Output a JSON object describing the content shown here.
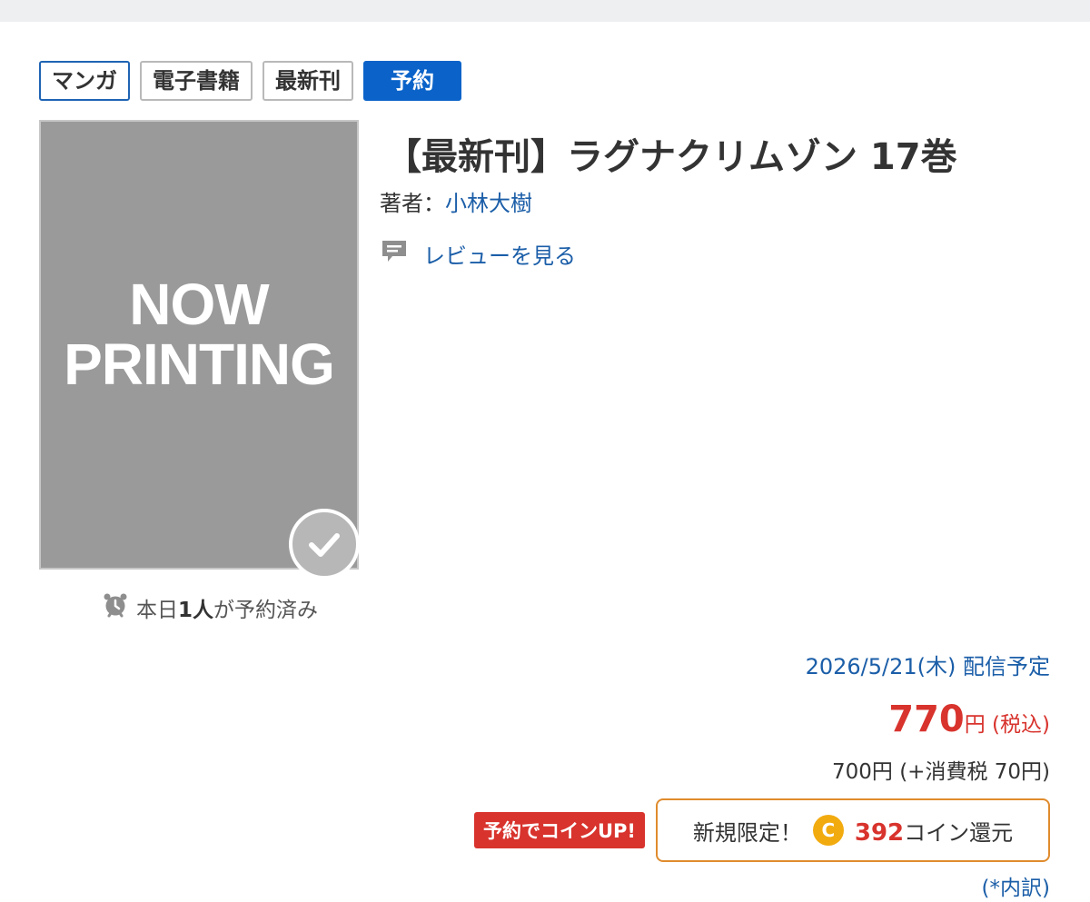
{
  "tags": {
    "manga": "マンガ",
    "ebook": "電子書籍",
    "latest": "最新刊",
    "reserve": "予約"
  },
  "cover": {
    "placeholder_line1": "NOW",
    "placeholder_line2": "PRINTING",
    "reserved_prefix": "本日",
    "reserved_count": "1人",
    "reserved_suffix": "が予約済み"
  },
  "product": {
    "title": "【最新刊】ラグナクリムゾン 17巻",
    "author_label": "著者：",
    "author_name": "小林大樹",
    "review_link": "レビューを見る"
  },
  "purchase": {
    "release_date": "2026/5/21(木) 配信予定",
    "price_value": "770",
    "price_unit": "円",
    "price_tax_label": "(税込)",
    "price_breakdown": "700円 (+消費税 70円)",
    "coin_up_badge": "予約でコインUP!",
    "coin_prefix": "新規限定！",
    "coin_icon_letter": "C",
    "coin_amount": "392",
    "coin_suffix": "コイン還元",
    "detail_link": "(*内訳)"
  },
  "colors": {
    "accent_blue": "#0b63c9",
    "link_blue": "#1b5ea8",
    "price_red": "#d8332d",
    "coin_orange": "#e08b2d",
    "coin_gold": "#f2ab0f"
  },
  "icons": {
    "check": "check-icon",
    "alarm": "alarm-clock-icon",
    "review": "comment-icon",
    "coin": "coin-icon"
  }
}
